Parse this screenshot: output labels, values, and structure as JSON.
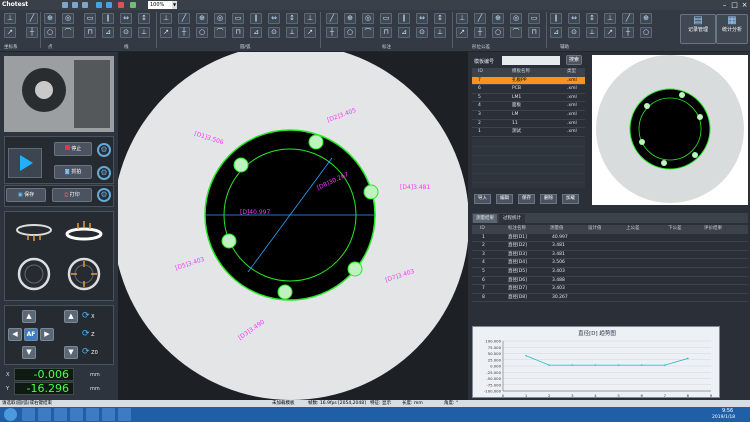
{
  "app": {
    "title": "Chotest",
    "zoom": "100%"
  },
  "ribbon": {
    "groups": [
      "坐标系",
      "点",
      "线",
      "圆/弧",
      "标注",
      "形位公差",
      "辅助"
    ],
    "big_buttons": [
      "记录管理",
      "统计分析"
    ]
  },
  "left": {
    "stop_label": "停止",
    "capture_label": "抓拍",
    "save_label": "保存",
    "print_label": "打印",
    "af_label": "AF",
    "axis_x": "X",
    "axis_y": "Y",
    "axis_z": "Z",
    "zoom_in_label": "Z",
    "zoom_out_label": "Z0",
    "coord_x_label": "X",
    "coord_y_label": "Y",
    "coord_x": "-0.006",
    "coord_y": "-16.296",
    "unit": "mm"
  },
  "image": {
    "labels": {
      "d1": "[D1]3.506",
      "d2": "[D2]3.405",
      "d3": "[D3]3.490",
      "d4": "[D4]3.481",
      "dia_big": "[D]40.997",
      "dia_mid": "[D8]30.267",
      "d5": "[D5]3.403",
      "d6": "[D6]3.488",
      "d7": "[D7]3.403"
    }
  },
  "templates": {
    "title": "模板编号",
    "search_label": "搜索",
    "headers": [
      "ID",
      "模板名称",
      "类型"
    ],
    "rows": [
      {
        "id": "7",
        "name": "孔板PP",
        "type": ".xml"
      },
      {
        "id": "6",
        "name": "PCB",
        "type": ".xml"
      },
      {
        "id": "5",
        "name": "LM1",
        "type": ".xml"
      },
      {
        "id": "4",
        "name": "面板",
        "type": ".xml"
      },
      {
        "id": "3",
        "name": "LM",
        "type": ".xml"
      },
      {
        "id": "2",
        "name": "11",
        "type": ".xml"
      },
      {
        "id": "1",
        "name": "测试",
        "type": ".xml"
      }
    ],
    "buttons": [
      "导入",
      "编辑",
      "保存",
      "删除",
      "加载"
    ]
  },
  "results": {
    "tabs": [
      "测量结果",
      "过程统计"
    ],
    "headers": [
      "ID",
      "标注名称",
      "测量值",
      "设计值",
      "上公差",
      "下公差",
      "评价结果"
    ],
    "rows": [
      {
        "id": "1",
        "name": "直径[D1]",
        "value": "40.997"
      },
      {
        "id": "2",
        "name": "直径[D2]",
        "value": "3.481"
      },
      {
        "id": "3",
        "name": "直径[D3]",
        "value": "3.481"
      },
      {
        "id": "4",
        "name": "直径[D4]",
        "value": "3.506"
      },
      {
        "id": "5",
        "name": "直径[D5]",
        "value": "3.403"
      },
      {
        "id": "6",
        "name": "直径[D6]",
        "value": "3.488"
      },
      {
        "id": "7",
        "name": "直径[D7]",
        "value": "3.403"
      },
      {
        "id": "8",
        "name": "直径[D8]",
        "value": "30.267"
      }
    ]
  },
  "chart_data": {
    "type": "line",
    "title": "直径[D] 趋势图",
    "x": [
      1,
      2,
      3,
      4,
      5,
      6,
      7,
      8
    ],
    "values": [
      40.997,
      3.481,
      3.481,
      3.506,
      3.403,
      3.488,
      3.403,
      30.267
    ],
    "ylim": [
      -100,
      100
    ],
    "yticks": [
      "100.000",
      "75.000",
      "50.000",
      "25.000",
      "0.000",
      "-25.000",
      "-50.000",
      "-75.000",
      "-100.000"
    ],
    "xticks": [
      "0",
      "1",
      "2",
      "3",
      "4",
      "5",
      "6",
      "7",
      "8",
      "9"
    ],
    "line_color": "#2fb7c9"
  },
  "status": {
    "left": "请选取(圆/弧)或右键结束",
    "middle": "未加载模板",
    "frame": "帧数: 16.9fps",
    "resolution": "[2054,2048]",
    "feature": "特征: 显示",
    "unit": "长度: mm",
    "angle": "角度: °"
  },
  "taskbar": {
    "time": "9:56",
    "date": "2019/1/18"
  }
}
